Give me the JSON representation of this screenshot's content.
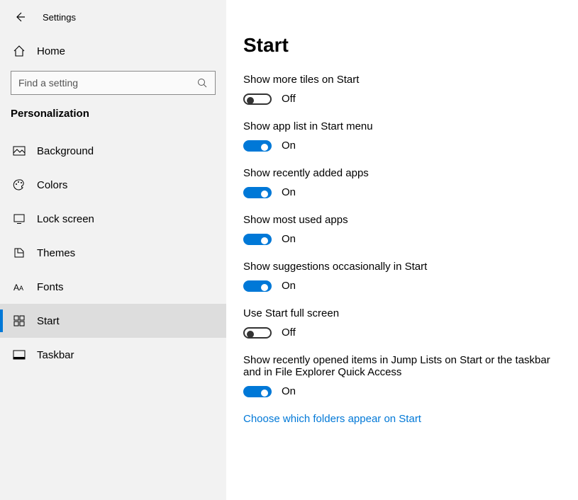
{
  "header": {
    "app_title": "Settings"
  },
  "sidebar": {
    "home_label": "Home",
    "search_placeholder": "Find a setting",
    "group_title": "Personalization",
    "items": [
      {
        "label": "Background",
        "key": "background"
      },
      {
        "label": "Colors",
        "key": "colors"
      },
      {
        "label": "Lock screen",
        "key": "lock-screen"
      },
      {
        "label": "Themes",
        "key": "themes"
      },
      {
        "label": "Fonts",
        "key": "fonts"
      },
      {
        "label": "Start",
        "key": "start"
      },
      {
        "label": "Taskbar",
        "key": "taskbar"
      }
    ]
  },
  "content": {
    "title": "Start",
    "settings": [
      {
        "label": "Show more tiles on Start",
        "on": false,
        "state": "Off"
      },
      {
        "label": "Show app list in Start menu",
        "on": true,
        "state": "On"
      },
      {
        "label": "Show recently added apps",
        "on": true,
        "state": "On"
      },
      {
        "label": "Show most used apps",
        "on": true,
        "state": "On"
      },
      {
        "label": "Show suggestions occasionally in Start",
        "on": true,
        "state": "On"
      },
      {
        "label": "Use Start full screen",
        "on": false,
        "state": "Off"
      },
      {
        "label": "Show recently opened items in Jump Lists on Start or the taskbar and in File Explorer Quick Access",
        "on": true,
        "state": "On"
      }
    ],
    "link_text": "Choose which folders appear on Start"
  }
}
